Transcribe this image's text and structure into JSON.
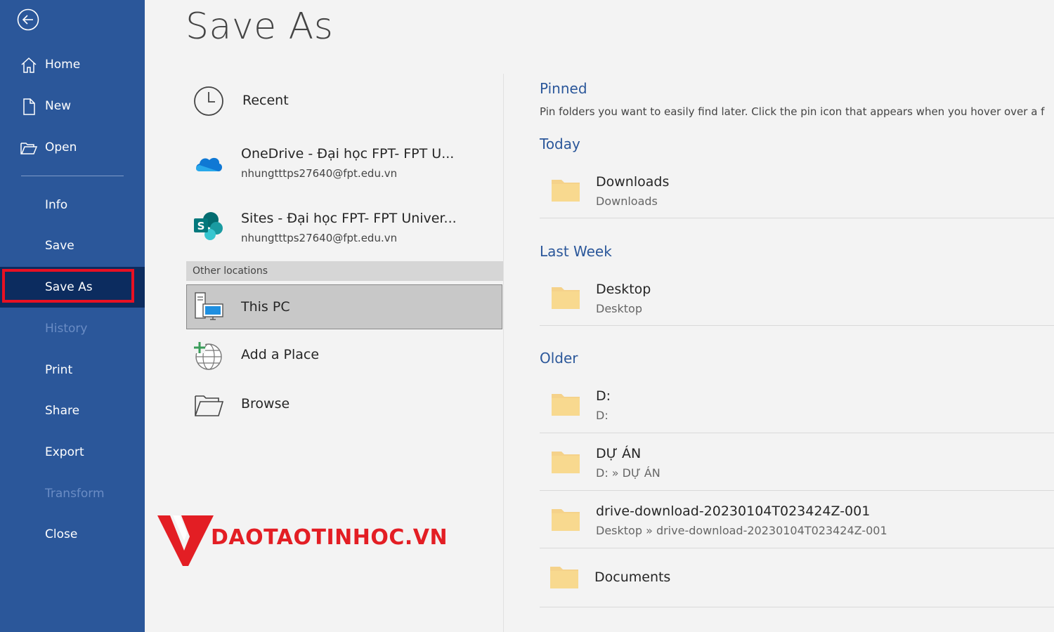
{
  "page": {
    "title": "Save As"
  },
  "sidebar": {
    "background": "#2b579a",
    "selected_background": "#0c2c5f",
    "items": [
      {
        "label": "Home",
        "icon": "home-icon"
      },
      {
        "label": "New",
        "icon": "new-document-icon"
      },
      {
        "label": "Open",
        "icon": "open-folder-icon"
      },
      {
        "label": "Info"
      },
      {
        "label": "Save"
      },
      {
        "label": "Save As",
        "selected": true
      },
      {
        "label": "History",
        "disabled": true
      },
      {
        "label": "Print"
      },
      {
        "label": "Share"
      },
      {
        "label": "Export"
      },
      {
        "label": "Transform",
        "disabled": true
      },
      {
        "label": "Close"
      }
    ]
  },
  "locations": {
    "recent": {
      "label": "Recent",
      "icon": "clock-icon"
    },
    "onedrive": {
      "label": "OneDrive - Đại học FPT- FPT U...",
      "account": "nhungtttps27640@fpt.edu.vn",
      "icon": "onedrive-cloud-icon"
    },
    "sites": {
      "label": "Sites - Đại học FPT- FPT Univer...",
      "account": "nhungtttps27640@fpt.edu.vn",
      "icon": "sharepoint-icon"
    },
    "other_header": "Other locations",
    "this_pc": {
      "label": "This PC",
      "icon": "computer-icon"
    },
    "add_place": {
      "label": "Add a Place",
      "icon": "globe-add-icon"
    },
    "browse": {
      "label": "Browse",
      "icon": "folder-open-icon"
    }
  },
  "folders": {
    "pinned_label": "Pinned",
    "pinned_desc": "Pin folders you want to easily find later. Click the pin icon that appears when you hover over a f",
    "today_label": "Today",
    "last_week_label": "Last Week",
    "older_label": "Older",
    "today": [
      {
        "name": "Downloads",
        "path": "Downloads"
      }
    ],
    "last_week": [
      {
        "name": "Desktop",
        "path": "Desktop"
      }
    ],
    "older": [
      {
        "name": "D:",
        "path": "D:"
      },
      {
        "name": "DỰ ÁN",
        "path": "D: » DỰ ÁN"
      },
      {
        "name": "drive-download-20230104T023424Z-001",
        "path": "Desktop » drive-download-20230104T023424Z-001"
      },
      {
        "name": "Documents",
        "path": ""
      }
    ]
  },
  "watermark": {
    "text": "DAOTAOTINHOC.VN"
  },
  "colors": {
    "accent": "#2b579a",
    "folder": "#f5d28a",
    "highlight_border": "#e81123",
    "watermark": "#e31e24"
  }
}
